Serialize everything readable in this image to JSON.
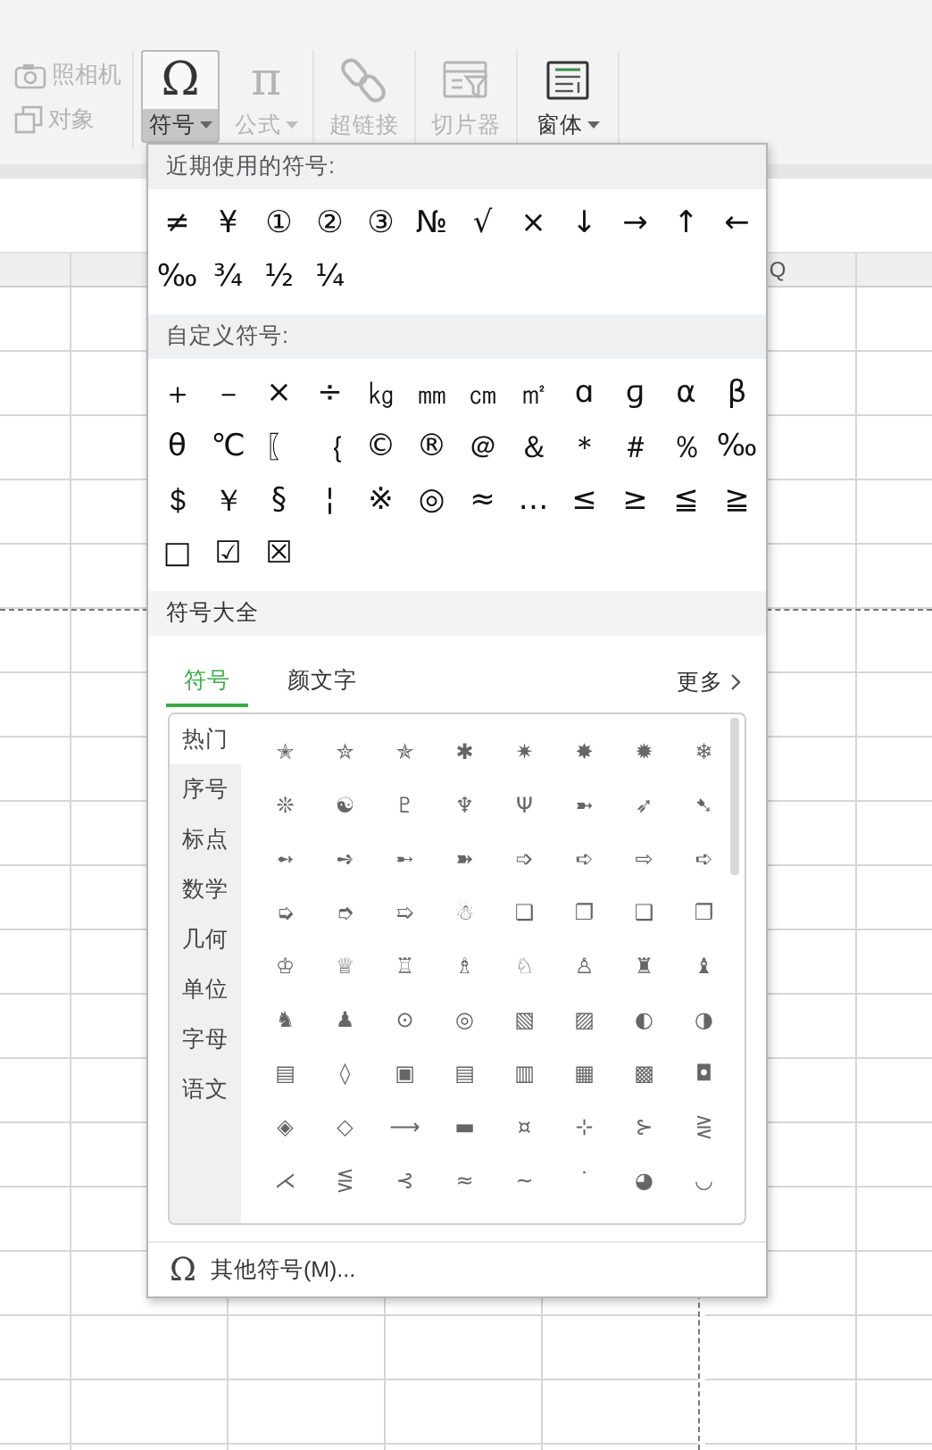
{
  "ribbon": {
    "groups": [
      {
        "items": [
          {
            "kind": "camera",
            "label": "照相机",
            "disabled": true
          },
          {
            "kind": "object",
            "label": "对象",
            "disabled": true
          }
        ]
      },
      {
        "items": [
          {
            "kind": "glyph",
            "symbol": "Ω",
            "label": "符号",
            "disabled": false,
            "selected": true,
            "dropdown": true
          },
          {
            "kind": "glyph",
            "symbol": "π",
            "label": "公式",
            "disabled": true,
            "selected": false,
            "dropdown": true
          }
        ]
      },
      {
        "items": [
          {
            "kind": "link",
            "label": "超链接",
            "disabled": true,
            "selected": false,
            "dropdown": false
          }
        ]
      },
      {
        "items": [
          {
            "kind": "slicer",
            "label": "切片器",
            "disabled": true,
            "selected": false,
            "dropdown": false
          }
        ]
      },
      {
        "items": [
          {
            "kind": "form",
            "label": "窗体",
            "disabled": false,
            "selected": false,
            "dropdown": true
          }
        ]
      }
    ]
  },
  "sheet": {
    "column_header": "Q"
  },
  "symbol_menu": {
    "recent_title": "近期使用的符号:",
    "recent": [
      "≠",
      "¥",
      "①",
      "②",
      "③",
      "№",
      "√",
      "×",
      "↓",
      "→",
      "↑",
      "←",
      "‰",
      "¾",
      "½",
      "¼"
    ],
    "custom_title": "自定义符号:",
    "custom": [
      "＋",
      "－",
      "×",
      "÷",
      "㎏",
      "㎜",
      "㎝",
      "㎡",
      "ɑ",
      "ɡ",
      "α",
      "β",
      "θ",
      "℃",
      "〖",
      "｛",
      "©",
      "®",
      "＠",
      "＆",
      "＊",
      "＃",
      "％",
      "‰",
      "＄",
      "￥",
      "§",
      "¦",
      "※",
      "◎",
      "≈",
      "…",
      "≤",
      "≥",
      "≦",
      "≧",
      "□",
      "☑",
      "☒"
    ],
    "all_title": "符号大全",
    "tabs": [
      {
        "label": "符号",
        "selected": true
      },
      {
        "label": "颜文字",
        "selected": false
      }
    ],
    "more": "更多",
    "categories": [
      {
        "label": "热门",
        "selected": true
      },
      {
        "label": "序号",
        "selected": false
      },
      {
        "label": "标点",
        "selected": false
      },
      {
        "label": "数学",
        "selected": false
      },
      {
        "label": "几何",
        "selected": false
      },
      {
        "label": "单位",
        "selected": false
      },
      {
        "label": "字母",
        "selected": false
      },
      {
        "label": "语文",
        "selected": false
      }
    ],
    "symbols": [
      "✭",
      "✮",
      "✯",
      "✱",
      "✷",
      "✸",
      "✹",
      "❄",
      "❊",
      "☯",
      "♇",
      "♆",
      "Ψ",
      "➼",
      "➶",
      "➷",
      "➻",
      "➺",
      "➸",
      "➽",
      "➩",
      "➪",
      "⇨",
      "➪",
      "➭",
      "➮",
      "➯",
      "☃",
      "❏",
      "❐",
      "❑",
      "❒",
      "♔",
      "♕",
      "♖",
      "♗",
      "♘",
      "♙",
      "♜",
      "♝",
      "♞",
      "♟",
      "⊙",
      "◎",
      "▧",
      "▨",
      "◐",
      "◑",
      "▤",
      "◊",
      "▣",
      "▤",
      "▥",
      "▦",
      "▩",
      "◘",
      "◈",
      "◇",
      "⟶",
      "▬",
      "¤",
      "⊹",
      "⊱",
      "⋛",
      "⋌",
      "⋚",
      "⊰",
      "≈",
      "∼",
      "˙",
      "◕",
      "◡"
    ],
    "footer": {
      "symbol": "Ω",
      "label": "其他符号(M)..."
    }
  }
}
